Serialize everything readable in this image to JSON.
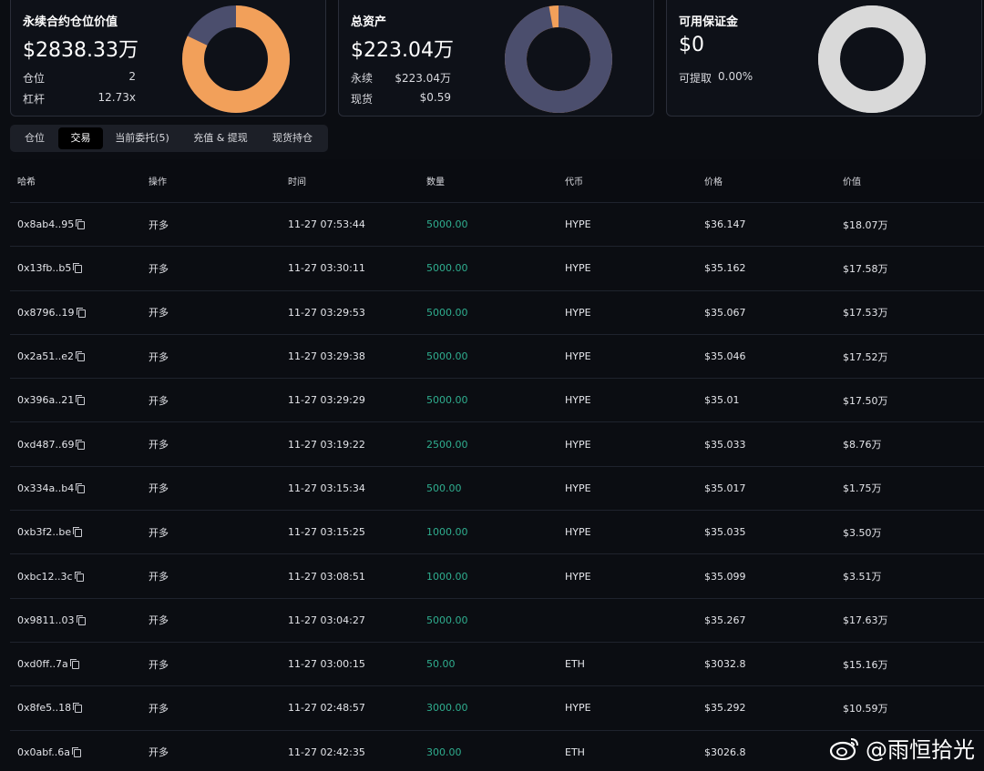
{
  "card1": {
    "title": "永续合约仓位价值",
    "value": "$2838.33万",
    "rows": [
      {
        "label": "仓位",
        "value": "2"
      },
      {
        "label": "杠杆",
        "value": "12.73x"
      }
    ],
    "donut": {
      "primary_fraction": 0.82,
      "primary_color": "#f2a05a",
      "secondary_color": "#4b4e6d"
    }
  },
  "card2": {
    "title": "总资产",
    "value": "$223.04万",
    "rows": [
      {
        "label": "永续",
        "value": "$223.04万"
      },
      {
        "label": "现货",
        "value": "$0.59"
      }
    ],
    "donut": {
      "primary_fraction": 0.97,
      "primary_color": "#4b4e6d",
      "secondary_color": "#f2a05a"
    }
  },
  "card3": {
    "title": "可用保证金",
    "value": "$0",
    "rows": [
      {
        "label": "可提取",
        "value": "0.00%"
      }
    ],
    "donut": {
      "primary_fraction": 1.0,
      "primary_color": "#d9d9d9",
      "secondary_color": "#d9d9d9"
    }
  },
  "tabs": [
    "仓位",
    "交易",
    "当前委托(5)",
    "充值 & 提现",
    "现货持仓"
  ],
  "active_tab": "交易",
  "table": {
    "headers": [
      "哈希",
      "操作",
      "时间",
      "数量",
      "代币",
      "价格",
      "价值"
    ],
    "rows": [
      [
        "0x8ab4..95",
        "开多",
        "11-27 07:53:44",
        "5000.00",
        "HYPE",
        "$36.147",
        "$18.07万"
      ],
      [
        "0x13fb..b5",
        "开多",
        "11-27 03:30:11",
        "5000.00",
        "HYPE",
        "$35.162",
        "$17.58万"
      ],
      [
        "0x8796..19",
        "开多",
        "11-27 03:29:53",
        "5000.00",
        "HYPE",
        "$35.067",
        "$17.53万"
      ],
      [
        "0x2a51..e2",
        "开多",
        "11-27 03:29:38",
        "5000.00",
        "HYPE",
        "$35.046",
        "$17.52万"
      ],
      [
        "0x396a..21",
        "开多",
        "11-27 03:29:29",
        "5000.00",
        "HYPE",
        "$35.01",
        "$17.50万"
      ],
      [
        "0xd487..69",
        "开多",
        "11-27 03:19:22",
        "2500.00",
        "HYPE",
        "$35.033",
        "$8.76万"
      ],
      [
        "0x334a..b4",
        "开多",
        "11-27 03:15:34",
        "500.00",
        "HYPE",
        "$35.017",
        "$1.75万"
      ],
      [
        "0xb3f2..be",
        "开多",
        "11-27 03:15:25",
        "1000.00",
        "HYPE",
        "$35.035",
        "$3.50万"
      ],
      [
        "0xbc12..3c",
        "开多",
        "11-27 03:08:51",
        "1000.00",
        "HYPE",
        "$35.099",
        "$3.51万"
      ],
      [
        "0x9811..03",
        "开多",
        "11-27 03:04:27",
        "5000.00",
        "",
        "$35.267",
        "$17.63万"
      ],
      [
        "0xd0ff..7a",
        "开多",
        "11-27 03:00:15",
        "50.00",
        "ETH",
        "$3032.8",
        "$15.16万"
      ],
      [
        "0x8fe5..18",
        "开多",
        "11-27 02:48:57",
        "3000.00",
        "HYPE",
        "$35.292",
        "$10.59万"
      ],
      [
        "0x0abf..6a",
        "开多",
        "11-27 02:42:35",
        "300.00",
        "ETH",
        "$3026.8",
        ""
      ]
    ]
  },
  "watermark": "@雨恒拾光"
}
